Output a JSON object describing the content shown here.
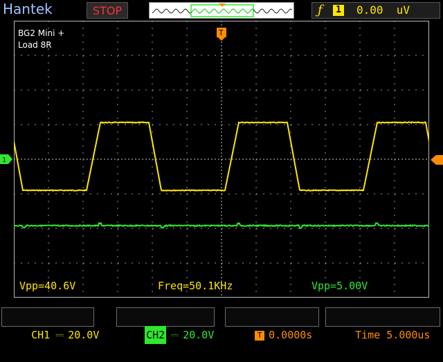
{
  "brand": "Hantek",
  "run_state": "STOP",
  "trigger": {
    "edge_symbol": "ƒ",
    "source": "1",
    "level": "0.00  uV"
  },
  "annotation": {
    "line1": "BG2 Mini +",
    "line2": "Load 8R"
  },
  "markers": {
    "trigger_position": "T"
  },
  "measurements": {
    "ch1_vpp": "Vpp=40.6V",
    "frequency": "Freq=50.1KHz",
    "ch2_vpp": "Vpp=5.00V"
  },
  "status": {
    "ch1_label": "CH1",
    "ch1_scale": "20.0V",
    "ch2_label": "CH2",
    "ch2_scale": "20.0V",
    "trigger_offset": "0.0000s",
    "time_label": "Time",
    "time_scale": "5.000us"
  },
  "colors": {
    "ch1": "#ffe600",
    "ch2": "#2ee82e",
    "trigger": "#ff8c00",
    "grid": "#ffffff"
  }
}
